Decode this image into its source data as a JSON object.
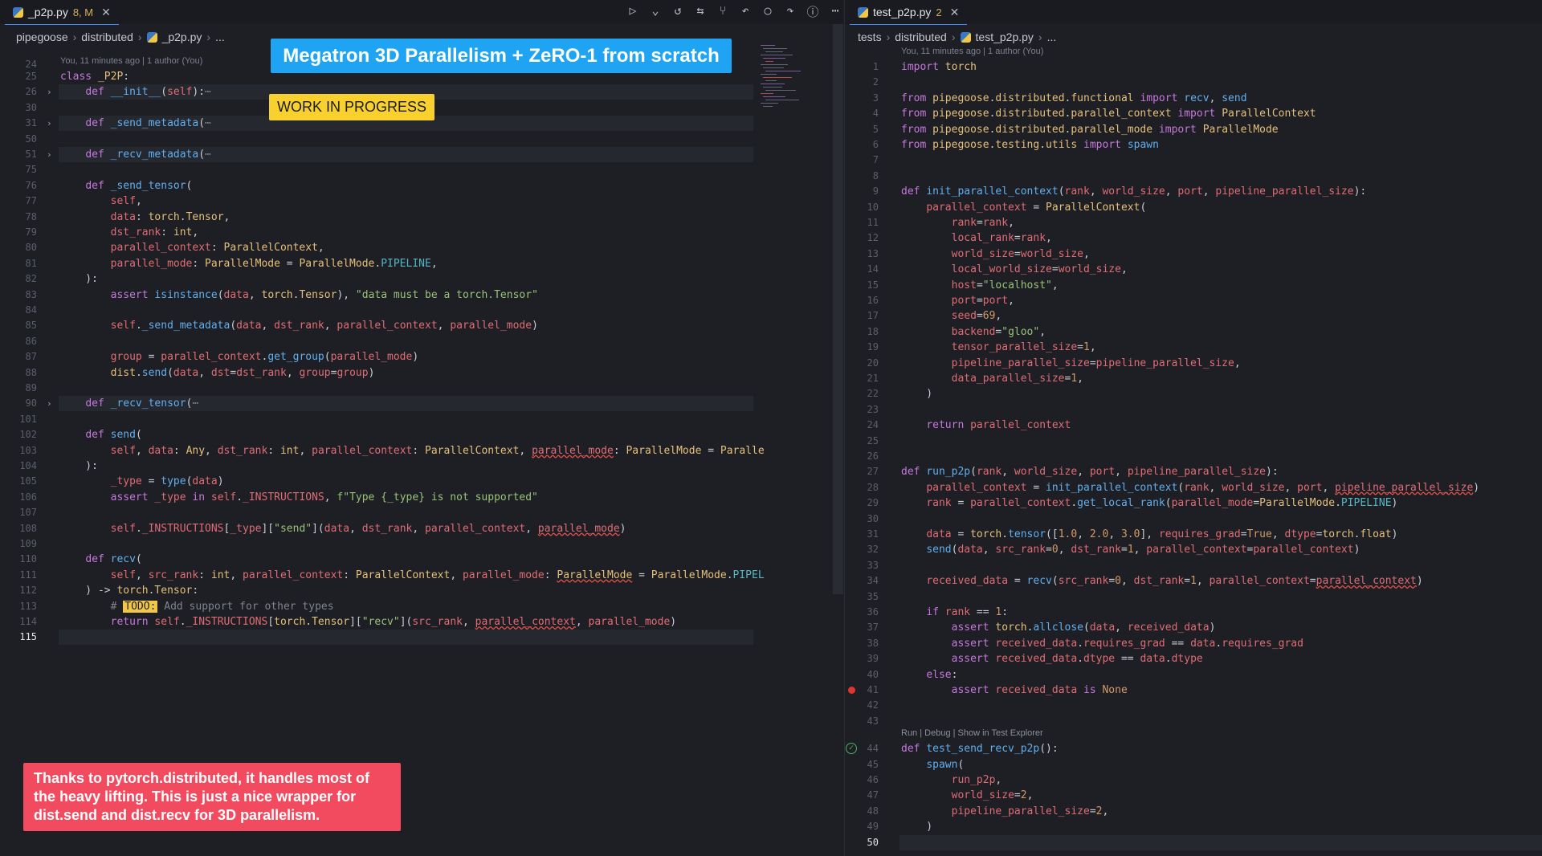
{
  "left": {
    "tab": {
      "name": "_p2p.py",
      "badge": "8, M",
      "close": "✕"
    },
    "breadcrumb": [
      "pipegoose",
      "distributed",
      "_p2p.py",
      "..."
    ],
    "blame": "You, 11 minutes ago | 1 author (You)",
    "first_line_number": "24",
    "lines": [
      {
        "n": "25",
        "html": "<span class=\"k\">class</span> <span class=\"t\">_P2P</span>:"
      },
      {
        "n": "26",
        "fold": true,
        "html": "    <span class=\"k\">def</span> <span class=\"f\">__init__</span>(<span class=\"p\">self</span>):<span class=\"c\">⋯</span>"
      },
      {
        "n": "30",
        "html": ""
      },
      {
        "n": "31",
        "fold": true,
        "html": "    <span class=\"k\">def</span> <span class=\"f\">_send_metadata</span>(<span class=\"c\">⋯</span>"
      },
      {
        "n": "50",
        "html": ""
      },
      {
        "n": "51",
        "fold": true,
        "html": "    <span class=\"k\">def</span> <span class=\"f\">_recv_metadata</span>(<span class=\"c\">⋯</span>"
      },
      {
        "n": "75",
        "html": ""
      },
      {
        "n": "76",
        "html": "    <span class=\"k\">def</span> <span class=\"f\">_send_tensor</span>("
      },
      {
        "n": "77",
        "html": "        <span class=\"p\">self</span>,"
      },
      {
        "n": "78",
        "html": "        <span class=\"p\">data</span>: <span class=\"t\">torch</span>.<span class=\"t\">Tensor</span>,"
      },
      {
        "n": "79",
        "html": "        <span class=\"p\">dst_rank</span>: <span class=\"t\">int</span>,"
      },
      {
        "n": "80",
        "html": "        <span class=\"p\">parallel_context</span>: <span class=\"t\">ParallelContext</span>,"
      },
      {
        "n": "81",
        "html": "        <span class=\"p\">parallel_mode</span>: <span class=\"t\">ParallelMode</span> = <span class=\"t\">ParallelMode</span>.<span class=\"q\">PIPELINE</span>,"
      },
      {
        "n": "82",
        "html": "    ):"
      },
      {
        "n": "83",
        "html": "        <span class=\"k\">assert</span> <span class=\"f\">isinstance</span>(<span class=\"p\">data</span>, <span class=\"t\">torch</span>.<span class=\"t\">Tensor</span>), <span class=\"s\">\"data must be a torch.Tensor\"</span>"
      },
      {
        "n": "84",
        "html": ""
      },
      {
        "n": "85",
        "html": "        <span class=\"p\">self</span>.<span class=\"f\">_send_metadata</span>(<span class=\"p\">data</span>, <span class=\"p\">dst_rank</span>, <span class=\"p\">parallel_context</span>, <span class=\"p\">parallel_mode</span>)"
      },
      {
        "n": "86",
        "html": ""
      },
      {
        "n": "87",
        "html": "        <span class=\"p\">group</span> = <span class=\"p\">parallel_context</span>.<span class=\"f\">get_group</span>(<span class=\"p\">parallel_mode</span>)"
      },
      {
        "n": "88",
        "html": "        <span class=\"t\">dist</span>.<span class=\"f\">send</span>(<span class=\"p\">data</span>, <span class=\"p\">dst</span>=<span class=\"p\">dst_rank</span>, <span class=\"p\">group</span>=<span class=\"p\">group</span>)"
      },
      {
        "n": "89",
        "html": ""
      },
      {
        "n": "90",
        "fold": true,
        "html": "    <span class=\"k\">def</span> <span class=\"f\">_recv_tensor</span>(<span class=\"c\">⋯</span>"
      },
      {
        "n": "101",
        "html": ""
      },
      {
        "n": "102",
        "html": "    <span class=\"k\">def</span> <span class=\"f\">send</span>("
      },
      {
        "n": "103",
        "html": "        <span class=\"p\">self</span>, <span class=\"p\">data</span>: <span class=\"t\">Any</span>, <span class=\"p\">dst_rank</span>: <span class=\"t\">int</span>, <span class=\"p\">parallel_context</span>: <span class=\"t\">ParallelContext</span>, <span class=\"p squig\">parallel_mode</span>: <span class=\"t\">ParallelMode</span> = <span class=\"t\">Paralle</span>"
      },
      {
        "n": "104",
        "html": "    ):"
      },
      {
        "n": "105",
        "html": "        <span class=\"p\">_type</span> = <span class=\"f\">type</span>(<span class=\"p\">data</span>)"
      },
      {
        "n": "106",
        "html": "        <span class=\"k\">assert</span> <span class=\"p\">_type</span> <span class=\"k\">in</span> <span class=\"p\">self</span>.<span class=\"p\">_INSTRUCTIONS</span>, <span class=\"s\">f\"Type {_type} is not supported\"</span>"
      },
      {
        "n": "107",
        "html": ""
      },
      {
        "n": "108",
        "html": "        <span class=\"p\">self</span>.<span class=\"p\">_INSTRUCTIONS</span>[<span class=\"p\">_type</span>][<span class=\"s\">\"send\"</span>](<span class=\"p\">data</span>, <span class=\"p\">dst_rank</span>, <span class=\"p\">parallel_context</span>, <span class=\"p squig\">parallel_mode</span>)"
      },
      {
        "n": "109",
        "html": ""
      },
      {
        "n": "110",
        "html": "    <span class=\"k\">def</span> <span class=\"f\">recv</span>("
      },
      {
        "n": "111",
        "html": "        <span class=\"p\">self</span>, <span class=\"p\">src_rank</span>: <span class=\"t\">int</span>, <span class=\"p\">parallel_context</span>: <span class=\"t\">ParallelContext</span>, <span class=\"p\">parallel_mode</span>: <span class=\"t squig\">ParallelMode</span> = <span class=\"t\">ParallelMode</span>.<span class=\"q\">PIPEL</span>"
      },
      {
        "n": "112",
        "html": "    ) -> <span class=\"t\">torch</span>.<span class=\"t\">Tensor</span>:"
      },
      {
        "n": "113",
        "html": "        <span class=\"c\"># </span><span class=\"todo\">TODO:</span><span class=\"c\"> Add support for other types</span>"
      },
      {
        "n": "114",
        "html": "        <span class=\"k\">return</span> <span class=\"p\">self</span>.<span class=\"p\">_INSTRUCTIONS</span>[<span class=\"t\">torch</span>.<span class=\"t\">Tensor</span>][<span class=\"s\">\"recv\"</span>](<span class=\"p\">src_rank</span>, <span class=\"p squig\">parallel_context</span>, <span class=\"p\">parallel_mode</span>)"
      },
      {
        "n": "115",
        "cur": true,
        "html": ""
      }
    ]
  },
  "right": {
    "tab": {
      "name": "test_p2p.py",
      "badge": "2",
      "close": "✕"
    },
    "breadcrumb": [
      "tests",
      "distributed",
      "test_p2p.py",
      "..."
    ],
    "blame": "You, 11 minutes ago | 1 author (You)",
    "codelens": "Run | Debug | Show in Test Explorer",
    "lines": [
      {
        "n": "1",
        "html": "<span class=\"k\">import</span> <span class=\"t\">torch</span>"
      },
      {
        "n": "2",
        "html": ""
      },
      {
        "n": "3",
        "html": "<span class=\"k\">from</span> <span class=\"t\">pipegoose</span>.<span class=\"t\">distributed</span>.<span class=\"t\">functional</span> <span class=\"k\">import</span> <span class=\"f\">recv</span>, <span class=\"f\">send</span>"
      },
      {
        "n": "4",
        "html": "<span class=\"k\">from</span> <span class=\"t\">pipegoose</span>.<span class=\"t\">distributed</span>.<span class=\"t\">parallel_context</span> <span class=\"k\">import</span> <span class=\"t\">ParallelContext</span>"
      },
      {
        "n": "5",
        "html": "<span class=\"k\">from</span> <span class=\"t\">pipegoose</span>.<span class=\"t\">distributed</span>.<span class=\"t\">parallel_mode</span> <span class=\"k\">import</span> <span class=\"t\">ParallelMode</span>"
      },
      {
        "n": "6",
        "html": "<span class=\"k\">from</span> <span class=\"t\">pipegoose</span>.<span class=\"t\">testing</span>.<span class=\"t\">utils</span> <span class=\"k\">import</span> <span class=\"f\">spawn</span>"
      },
      {
        "n": "7",
        "html": ""
      },
      {
        "n": "8",
        "html": ""
      },
      {
        "n": "9",
        "html": "<span class=\"k\">def</span> <span class=\"f\">init_parallel_context</span>(<span class=\"p\">rank</span>, <span class=\"p\">world_size</span>, <span class=\"p\">port</span>, <span class=\"p\">pipeline_parallel_size</span>):"
      },
      {
        "n": "10",
        "html": "    <span class=\"p\">parallel_context</span> = <span class=\"t\">ParallelContext</span>("
      },
      {
        "n": "11",
        "html": "        <span class=\"p\">rank</span>=<span class=\"p\">rank</span>,"
      },
      {
        "n": "12",
        "html": "        <span class=\"p\">local_rank</span>=<span class=\"p\">rank</span>,"
      },
      {
        "n": "13",
        "html": "        <span class=\"p\">world_size</span>=<span class=\"p\">world_size</span>,"
      },
      {
        "n": "14",
        "html": "        <span class=\"p\">local_world_size</span>=<span class=\"p\">world_size</span>,"
      },
      {
        "n": "15",
        "html": "        <span class=\"p\">host</span>=<span class=\"s\">\"localhost\"</span>,"
      },
      {
        "n": "16",
        "html": "        <span class=\"p\">port</span>=<span class=\"p\">port</span>,"
      },
      {
        "n": "17",
        "html": "        <span class=\"p\">seed</span>=<span class=\"n\">69</span>,"
      },
      {
        "n": "18",
        "html": "        <span class=\"p\">backend</span>=<span class=\"s\">\"gloo\"</span>,"
      },
      {
        "n": "19",
        "html": "        <span class=\"p\">tensor_parallel_size</span>=<span class=\"n\">1</span>,"
      },
      {
        "n": "20",
        "html": "        <span class=\"p\">pipeline_parallel_size</span>=<span class=\"p\">pipeline_parallel_size</span>,"
      },
      {
        "n": "21",
        "html": "        <span class=\"p\">data_parallel_size</span>=<span class=\"n\">1</span>,"
      },
      {
        "n": "22",
        "html": "    )"
      },
      {
        "n": "23",
        "html": ""
      },
      {
        "n": "24",
        "html": "    <span class=\"k\">return</span> <span class=\"p\">parallel_context</span>"
      },
      {
        "n": "25",
        "html": ""
      },
      {
        "n": "26",
        "html": ""
      },
      {
        "n": "27",
        "html": "<span class=\"k\">def</span> <span class=\"f\">run_p2p</span>(<span class=\"p\">rank</span>, <span class=\"p\">world_size</span>, <span class=\"p\">port</span>, <span class=\"p\">pipeline_parallel_size</span>):"
      },
      {
        "n": "28",
        "html": "    <span class=\"p\">parallel_context</span> = <span class=\"f\">init_parallel_context</span>(<span class=\"p\">rank</span>, <span class=\"p\">world_size</span>, <span class=\"p\">port</span>, <span class=\"p squig\">pipeline_parallel_size</span>)"
      },
      {
        "n": "29",
        "html": "    <span class=\"p\">rank</span> = <span class=\"p\">parallel_context</span>.<span class=\"f\">get_local_rank</span>(<span class=\"p\">parallel_mode</span>=<span class=\"t\">ParallelMode</span>.<span class=\"q\">PIPELINE</span>)"
      },
      {
        "n": "30",
        "html": ""
      },
      {
        "n": "31",
        "html": "    <span class=\"p\">data</span> = <span class=\"t\">torch</span>.<span class=\"f\">tensor</span>([<span class=\"n\">1.0</span>, <span class=\"n\">2.0</span>, <span class=\"n\">3.0</span>], <span class=\"p\">requires_grad</span>=<span class=\"n\">True</span>, <span class=\"p\">dtype</span>=<span class=\"t\">torch</span>.<span class=\"t\">float</span>)"
      },
      {
        "n": "32",
        "html": "    <span class=\"f\">send</span>(<span class=\"p\">data</span>, <span class=\"p\">src_rank</span>=<span class=\"n\">0</span>, <span class=\"p\">dst_rank</span>=<span class=\"n\">1</span>, <span class=\"p\">parallel_context</span>=<span class=\"p\">parallel_context</span>)"
      },
      {
        "n": "33",
        "html": ""
      },
      {
        "n": "34",
        "html": "    <span class=\"p\">received_data</span> = <span class=\"f\">recv</span>(<span class=\"p\">src_rank</span>=<span class=\"n\">0</span>, <span class=\"p\">dst_rank</span>=<span class=\"n\">1</span>, <span class=\"p\">parallel_context</span>=<span class=\"p squig\">parallel_context</span>)"
      },
      {
        "n": "35",
        "html": ""
      },
      {
        "n": "36",
        "html": "    <span class=\"k\">if</span> <span class=\"p\">rank</span> == <span class=\"n\">1</span>:"
      },
      {
        "n": "37",
        "html": "        <span class=\"k\">assert</span> <span class=\"t\">torch</span>.<span class=\"f\">allclose</span>(<span class=\"p\">data</span>, <span class=\"p\">received_data</span>)"
      },
      {
        "n": "38",
        "html": "        <span class=\"k\">assert</span> <span class=\"p\">received_data</span>.<span class=\"p\">requires_grad</span> == <span class=\"p\">data</span>.<span class=\"p\">requires_grad</span>"
      },
      {
        "n": "39",
        "html": "        <span class=\"k\">assert</span> <span class=\"p\">received_data</span>.<span class=\"p\">dtype</span> == <span class=\"p\">data</span>.<span class=\"p\">dtype</span>"
      },
      {
        "n": "40",
        "html": "    <span class=\"k\">else</span>:"
      },
      {
        "n": "41",
        "bp": true,
        "html": "        <span class=\"k\">assert</span> <span class=\"p\">received_data</span> <span class=\"k\">is</span> <span class=\"n\">None</span>"
      },
      {
        "n": "42",
        "html": ""
      },
      {
        "n": "43",
        "html": ""
      },
      {
        "n": "44",
        "check": true,
        "html": "<span class=\"k\">def</span> <span class=\"f\">test_send_recv_p2p</span>():"
      },
      {
        "n": "45",
        "html": "    <span class=\"f\">spawn</span>("
      },
      {
        "n": "46",
        "html": "        <span class=\"p\">run_p2p</span>,"
      },
      {
        "n": "47",
        "html": "        <span class=\"p\">world_size</span>=<span class=\"n\">2</span>,"
      },
      {
        "n": "48",
        "html": "        <span class=\"p\">pipeline_parallel_size</span>=<span class=\"n\">2</span>,"
      },
      {
        "n": "49",
        "html": "    )"
      },
      {
        "n": "50",
        "cur": true,
        "html": ""
      }
    ]
  },
  "overlays": {
    "title": "Megatron 3D Parallelism + ZeRO-1 from scratch",
    "wip": "WORK IN PROGRESS",
    "note": "Thanks to pytorch.distributed, it handles most of the heavy lifting. This is just a nice wrapper for dist.send and dist.recv for 3D parallelism."
  },
  "toolbar_icons": [
    "run-icon",
    "chevron-down-icon",
    "history-icon",
    "compare-icon",
    "pull-request-icon",
    "go-back-icon",
    "circle-icon",
    "go-forward-icon",
    "info-icon",
    "more-icon"
  ],
  "toolbar_glyphs": [
    "▷",
    "⌄",
    "↺",
    "⇆",
    "⑂",
    "↶",
    "○",
    "↷",
    "ⓘ",
    "⋯"
  ]
}
